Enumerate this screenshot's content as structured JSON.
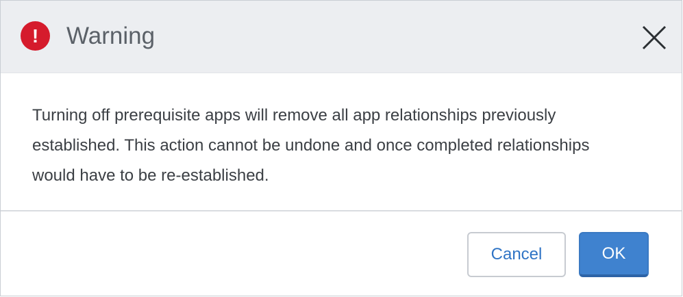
{
  "dialog": {
    "title": "Warning",
    "icon": "exclamation-icon",
    "message": "Turning off prerequisite apps will remove all app relationships previously established. This action cannot be undone and once completed relationships would have to be re-established.",
    "close_icon": "close-icon",
    "buttons": {
      "cancel_label": "Cancel",
      "ok_label": "OK"
    },
    "colors": {
      "warning_red": "#d51b2c",
      "primary_blue": "#3f82cf",
      "link_blue": "#2f74c5"
    }
  }
}
